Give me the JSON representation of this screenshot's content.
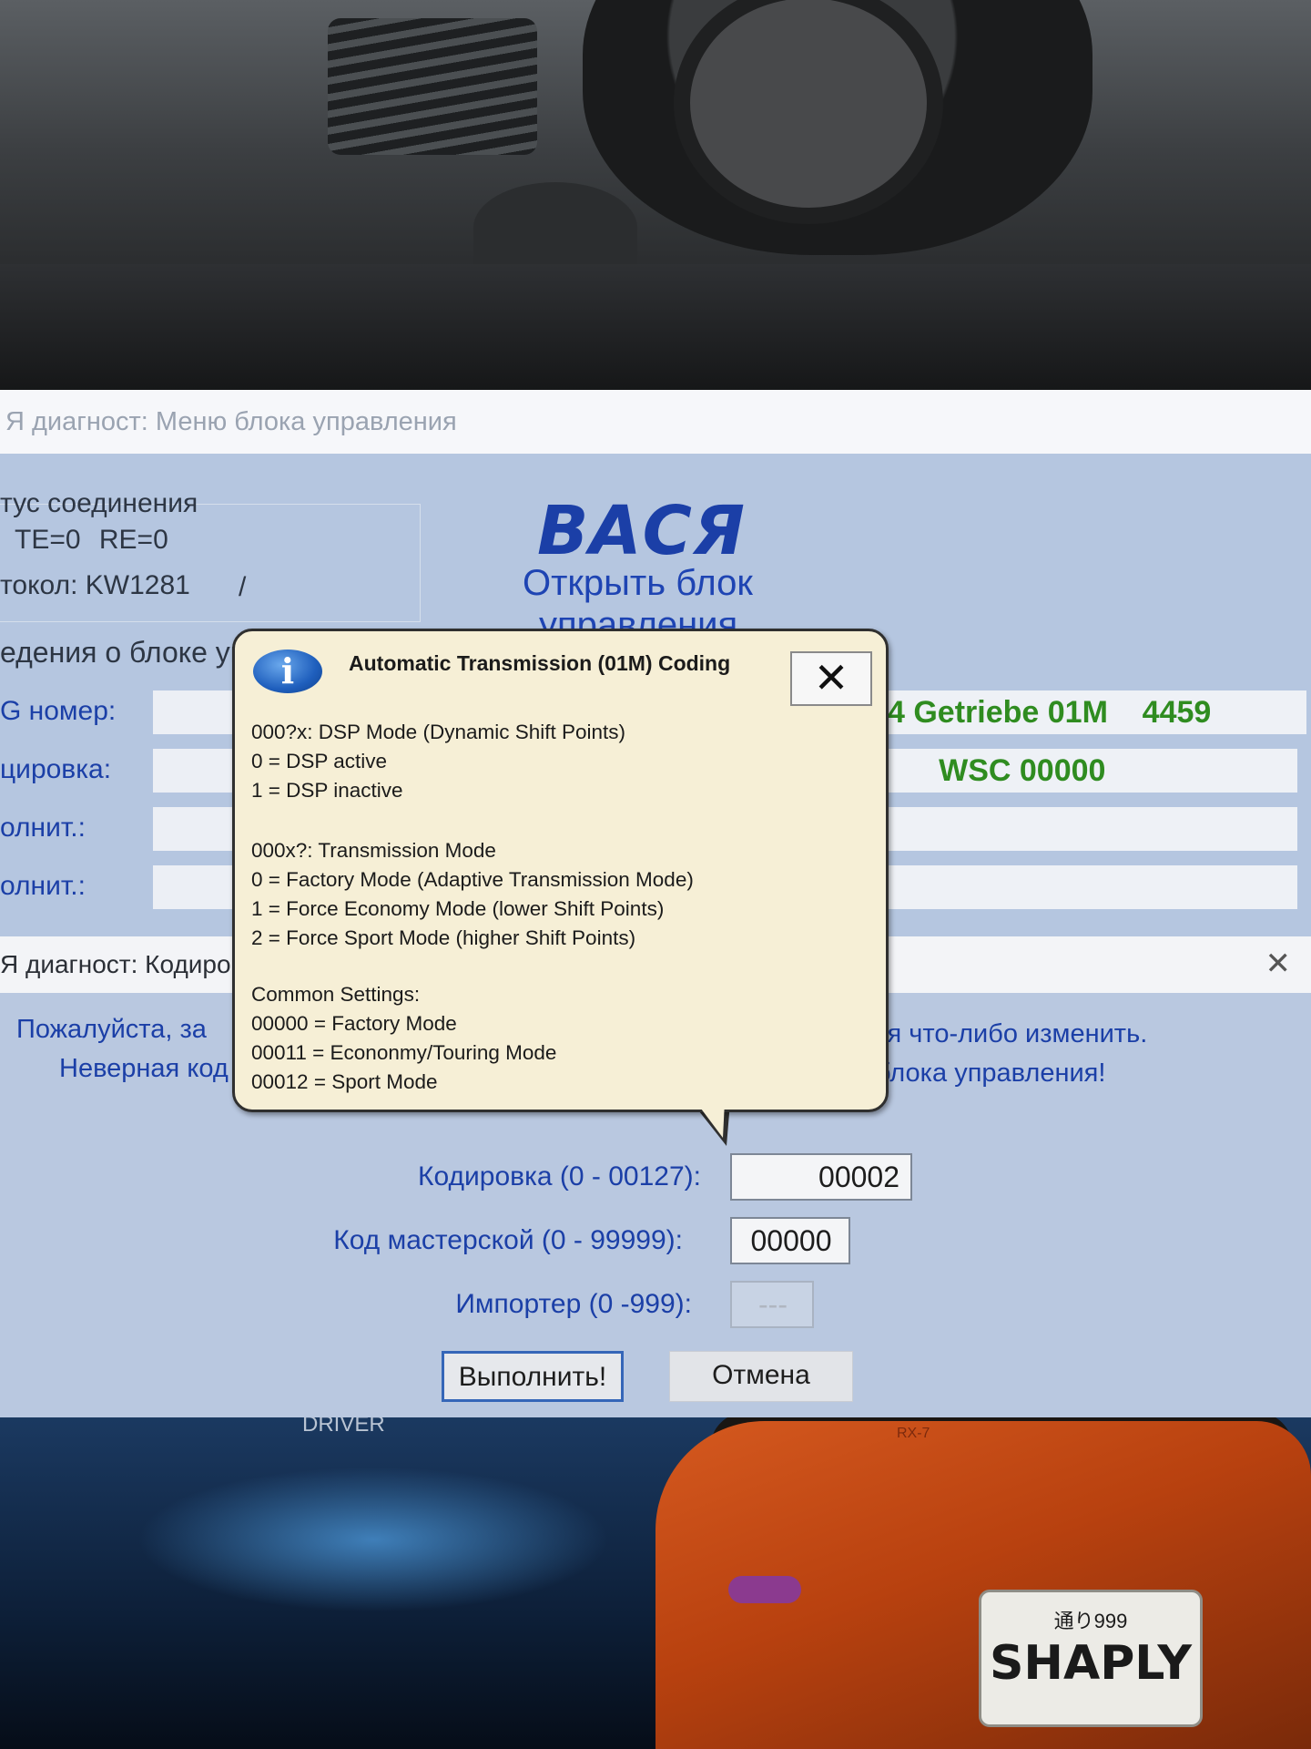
{
  "win1": {
    "title": "Я диагност: Меню блока управления",
    "conn_label": "тус соединения",
    "te_re": "TE=0 RE=0",
    "protocol": "токол: KW1281",
    "protocol_sep": "/",
    "logo": "ВАСЯ",
    "logo_sub1": "Открыть блок",
    "logo_sub2": "управления",
    "info_label": "едения о блоке уп",
    "rows": [
      {
        "label": "G номер:",
        "value": "4 Getriebe 01M    4459"
      },
      {
        "label": "цировка:",
        "value": "       WSC 00000"
      },
      {
        "label": "олнит.:",
        "value": ""
      },
      {
        "label": "олнит.:",
        "value": ""
      }
    ]
  },
  "win2": {
    "title": "Я диагност: Кодиро",
    "close": "✕",
    "msg1_left": "Пожалуйста, за",
    "msg1_right": "ся что-либо изменить.",
    "msg2_left": "Неверная код",
    "msg2_right": "блока управления!",
    "coding_label": "Кодировка (0 - 00127):",
    "coding_value": "00002",
    "workshop_label": "Код мастерской (0 - 99999):",
    "workshop_value": "00000",
    "importer_label": "Импортер (0 -999):",
    "importer_value": "---",
    "execute": "Выполнить!",
    "cancel": "Отмена"
  },
  "balloon": {
    "icon": "i",
    "title": "Automatic Transmission (01M) Coding",
    "close": "✕",
    "lines": [
      "000?x: DSP Mode (Dynamic Shift Points)",
      "0 = DSP active",
      "1 = DSP inactive",
      "000x?: Transmission Mode",
      "0 = Factory Mode (Adaptive Transmission Mode)",
      "1 = Force Economy Mode (lower Shift Points)",
      "2 = Force Sport Mode (higher Shift Points)",
      "Common Settings:",
      "00000 = Factory Mode",
      "00011 = Econonmy/Touring Mode",
      "00012 = Sport Mode"
    ]
  },
  "wallpaper": {
    "driver_text": "DRIVER",
    "car_badge": "RX-7",
    "plate_top": "通り999",
    "plate_main": "SHAPLY"
  },
  "colors": {
    "accent_blue": "#1b3fa7",
    "value_green": "#2f8c20",
    "window_bg": "#b5c6e0",
    "balloon_bg": "#f6efd6"
  }
}
